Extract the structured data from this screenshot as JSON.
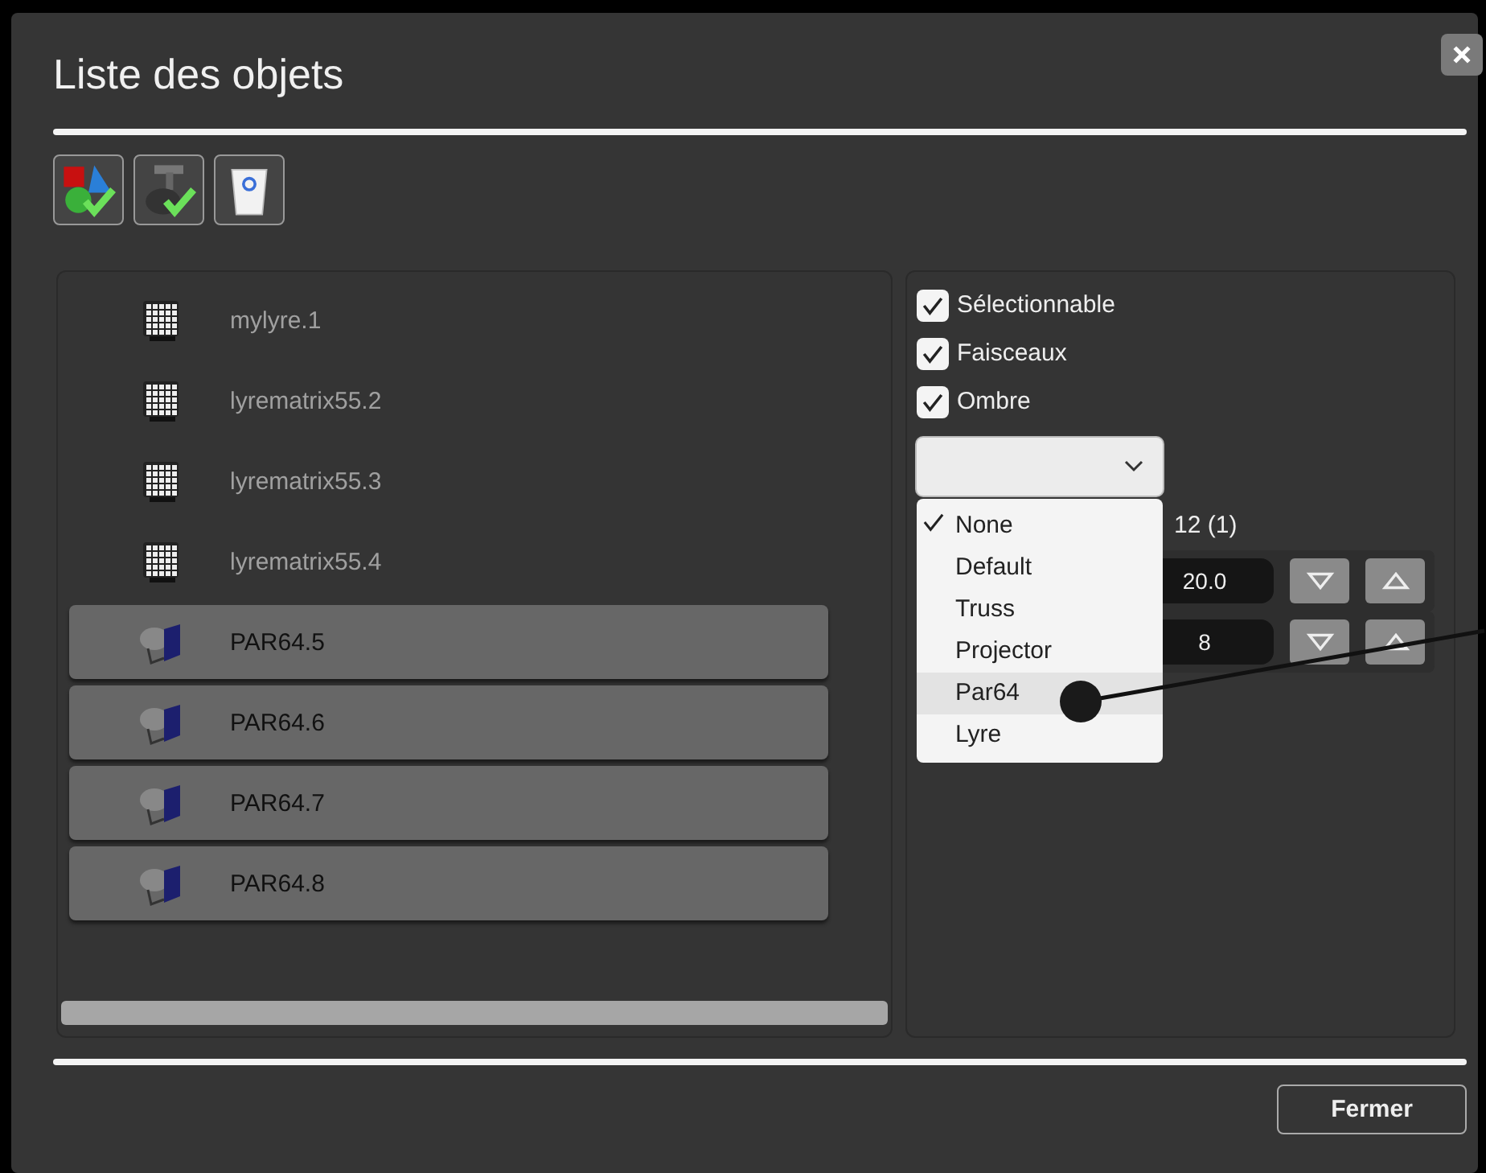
{
  "window": {
    "title": "Liste des objets"
  },
  "toolbar": [
    {
      "kind": "shapes"
    },
    {
      "kind": "fixture"
    },
    {
      "kind": "trash"
    }
  ],
  "objects": [
    {
      "name": "mylyre.1",
      "kind": "matrix",
      "selected": false
    },
    {
      "name": "lyrematrix55.2",
      "kind": "matrix",
      "selected": false
    },
    {
      "name": "lyrematrix55.3",
      "kind": "matrix",
      "selected": false
    },
    {
      "name": "lyrematrix55.4",
      "kind": "matrix",
      "selected": false
    },
    {
      "name": "PAR64.5",
      "kind": "par",
      "selected": true
    },
    {
      "name": "PAR64.6",
      "kind": "par",
      "selected": true
    },
    {
      "name": "PAR64.7",
      "kind": "par",
      "selected": true
    },
    {
      "name": "PAR64.8",
      "kind": "par",
      "selected": true
    }
  ],
  "properties": {
    "checkboxes": [
      {
        "label": "Sélectionnable",
        "checked": true
      },
      {
        "label": "Faisceaux",
        "checked": true
      },
      {
        "label": "Ombre",
        "checked": true
      }
    ],
    "dropdown": {
      "expanded": true,
      "options": [
        {
          "label": "None",
          "checked": true,
          "highlighted": false
        },
        {
          "label": "Default",
          "checked": false,
          "highlighted": false
        },
        {
          "label": "Truss",
          "checked": false,
          "highlighted": false
        },
        {
          "label": "Projector",
          "checked": false,
          "highlighted": false
        },
        {
          "label": "Par64",
          "checked": false,
          "highlighted": true
        },
        {
          "label": "Lyre",
          "checked": false,
          "highlighted": false
        }
      ]
    },
    "partial_label": "12 (1)",
    "spinners": [
      {
        "value": "20.0"
      },
      {
        "value": "8"
      }
    ]
  },
  "buttons": [
    {
      "label": "Fermer"
    }
  ]
}
